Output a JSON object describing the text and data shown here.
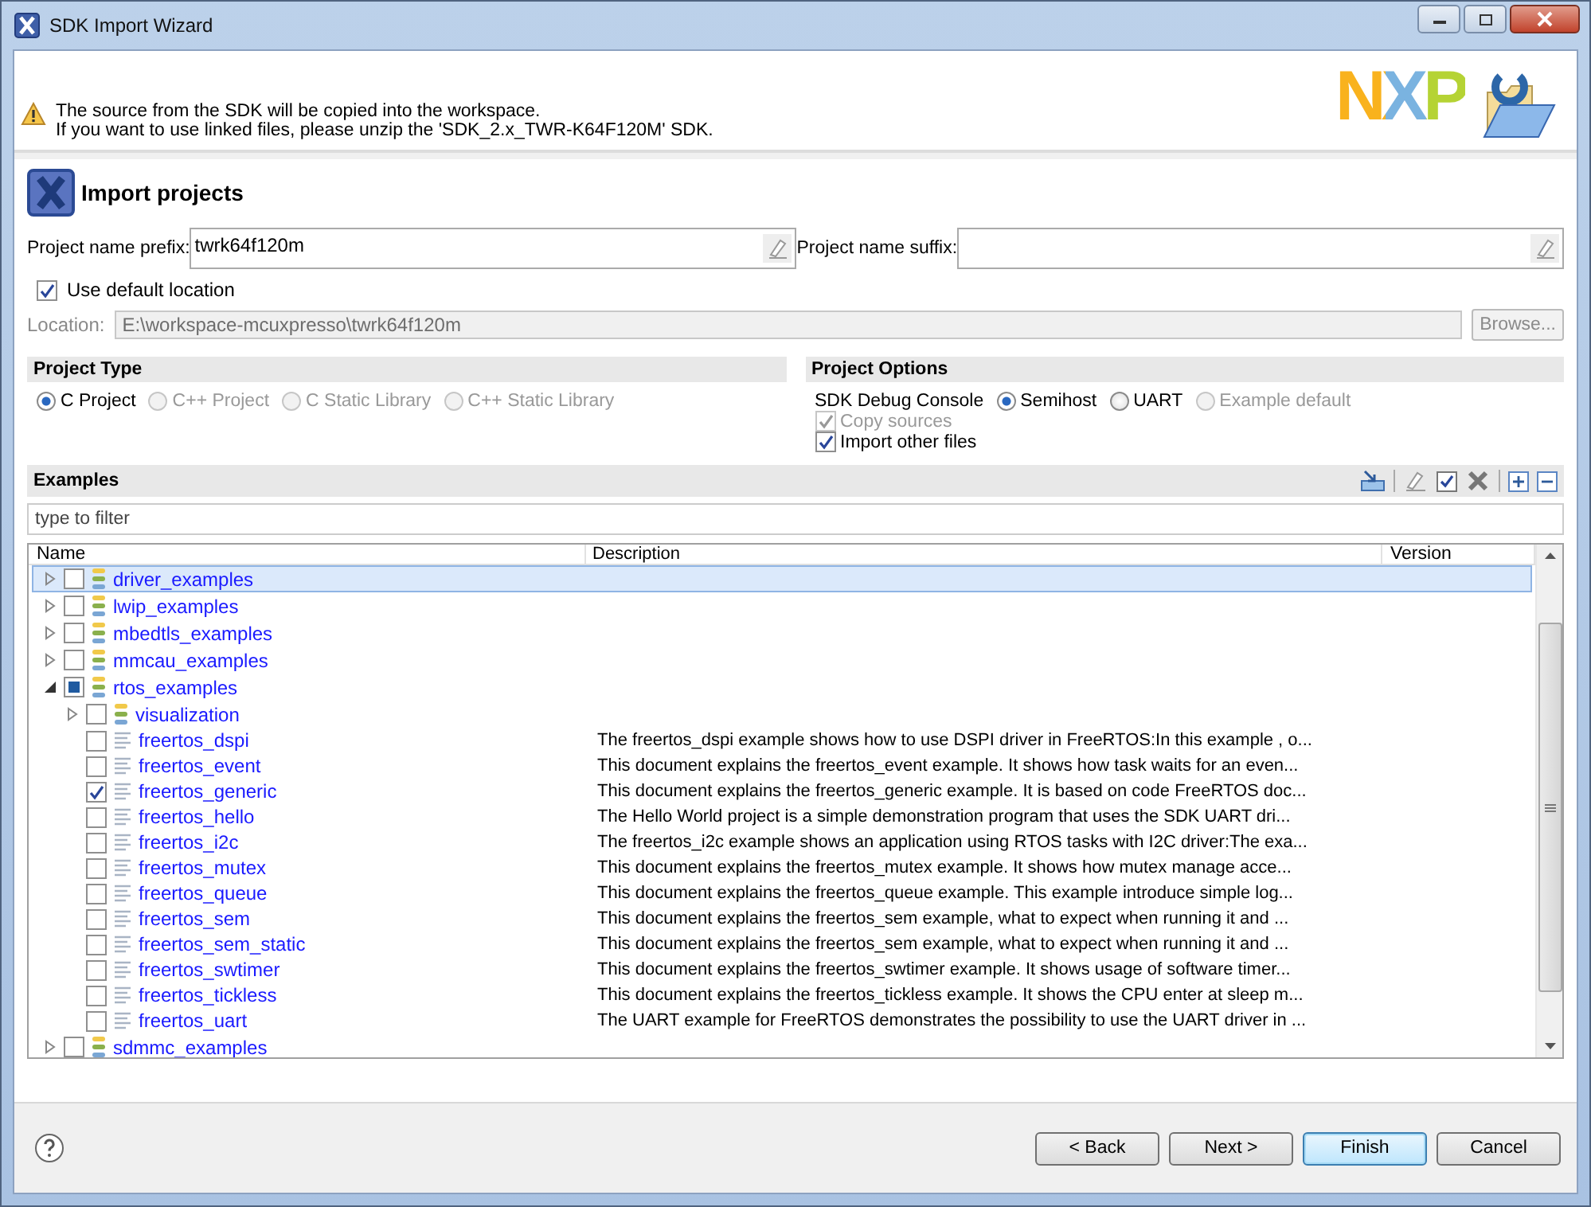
{
  "window": {
    "title": "SDK Import Wizard"
  },
  "banner": {
    "message": [
      "The source from the SDK will be copied into the workspace.",
      "If you want to use linked files, please unzip the 'SDK_2.x_TWR-K64F120M' SDK."
    ],
    "logo": "NXP"
  },
  "page": {
    "title": "Import projects"
  },
  "name_fields": [
    {
      "label": "Project name prefix:",
      "value": "twrk64f120m"
    },
    {
      "label": "Project name suffix:"
    }
  ],
  "use_default_location": {
    "label": "Use default location",
    "checked": true
  },
  "location": {
    "label": "Location:",
    "value": "E:\\workspace-mcuxpresso\\twrk64f120m",
    "disabled": true,
    "browse": "Browse..."
  },
  "project_type": {
    "title": "Project Type",
    "options": [
      {
        "label": "C Project",
        "selected": true,
        "disabled": false
      },
      {
        "label": "C++ Project",
        "selected": false,
        "disabled": true
      },
      {
        "label": "C Static Library",
        "selected": false,
        "disabled": true
      },
      {
        "label": "C++ Static Library",
        "selected": false,
        "disabled": true
      }
    ]
  },
  "project_options": {
    "title": "Project Options",
    "console_label": "SDK Debug Console",
    "console_options": [
      {
        "label": "Semihost",
        "selected": true,
        "disabled": false
      },
      {
        "label": "UART",
        "selected": false,
        "disabled": false
      },
      {
        "label": "Example default",
        "selected": false,
        "disabled": true
      }
    ],
    "checkboxes": [
      {
        "label": "Copy sources",
        "checked": true,
        "disabled": true
      },
      {
        "label": "Import other files",
        "checked": true,
        "disabled": false
      }
    ]
  },
  "examples": {
    "title": "Examples",
    "filter": {
      "placeholder": "type to filter"
    },
    "columns": [
      "Name",
      "Description",
      "Version"
    ],
    "rows": [
      {
        "kind": "group",
        "name": "driver_examples",
        "expanded": false,
        "checked": false,
        "partial": false,
        "selected": true
      },
      {
        "kind": "group",
        "name": "lwip_examples",
        "expanded": false,
        "checked": false,
        "partial": false,
        "selected": false
      },
      {
        "kind": "group",
        "name": "mbedtls_examples",
        "expanded": false,
        "checked": false,
        "partial": false,
        "selected": false
      },
      {
        "kind": "group",
        "name": "mmcau_examples",
        "expanded": false,
        "checked": false,
        "partial": false,
        "selected": false
      },
      {
        "kind": "group",
        "name": "rtos_examples",
        "expanded": true,
        "checked": false,
        "partial": true,
        "selected": false,
        "children": [
          {
            "kind": "group",
            "name": "visualization",
            "expanded": false,
            "checked": false,
            "partial": false,
            "selected": false
          },
          {
            "kind": "example",
            "name": "freertos_dspi",
            "description": "The freertos_dspi example shows how to use DSPI driver in FreeRTOS:In this example , o...",
            "checked": false,
            "partial": false,
            "selected": false
          },
          {
            "kind": "example",
            "name": "freertos_event",
            "description": "This document explains the freertos_event example. It shows how task waits for an even...",
            "checked": false,
            "partial": false,
            "selected": false
          },
          {
            "kind": "example",
            "name": "freertos_generic",
            "description": "This document explains the freertos_generic example. It is based on code FreeRTOS doc...",
            "checked": true,
            "partial": false,
            "selected": false
          },
          {
            "kind": "example",
            "name": "freertos_hello",
            "description": "The Hello World project is a simple demonstration program that uses the SDK UART dri...",
            "checked": false,
            "partial": false,
            "selected": false
          },
          {
            "kind": "example",
            "name": "freertos_i2c",
            "description": "The freertos_i2c example shows an application using RTOS tasks with I2C driver:The exa...",
            "checked": false,
            "partial": false,
            "selected": false
          },
          {
            "kind": "example",
            "name": "freertos_mutex",
            "description": "This document explains the freertos_mutex example. It shows how mutex manage acce...",
            "checked": false,
            "partial": false,
            "selected": false
          },
          {
            "kind": "example",
            "name": "freertos_queue",
            "description": "This document explains the freertos_queue example. This example introduce simple log...",
            "checked": false,
            "partial": false,
            "selected": false
          },
          {
            "kind": "example",
            "name": "freertos_sem",
            "description": "This document explains the freertos_sem example, what to expect when running it and ...",
            "checked": false,
            "partial": false,
            "selected": false
          },
          {
            "kind": "example",
            "name": "freertos_sem_static",
            "description": "This document explains the freertos_sem example, what to expect when running it and ...",
            "checked": false,
            "partial": false,
            "selected": false
          },
          {
            "kind": "example",
            "name": "freertos_swtimer",
            "description": "This document explains the freertos_swtimer example. It shows usage of software timer...",
            "checked": false,
            "partial": false,
            "selected": false
          },
          {
            "kind": "example",
            "name": "freertos_tickless",
            "description": "This document explains the freertos_tickless example. It shows the CPU enter at sleep m...",
            "checked": false,
            "partial": false,
            "selected": false
          },
          {
            "kind": "example",
            "name": "freertos_uart",
            "description": "The UART example for FreeRTOS demonstrates the possibility to use the UART driver in ...",
            "checked": false,
            "partial": false,
            "selected": false
          }
        ]
      },
      {
        "kind": "group",
        "name": "sdmmc_examples",
        "expanded": false,
        "checked": false,
        "partial": false,
        "selected": false
      }
    ]
  },
  "footer": {
    "buttons": [
      {
        "label": "< Back",
        "default": false
      },
      {
        "label": "Next >",
        "default": false
      },
      {
        "label": "Finish",
        "default": true
      },
      {
        "label": "Cancel",
        "default": false
      }
    ]
  }
}
